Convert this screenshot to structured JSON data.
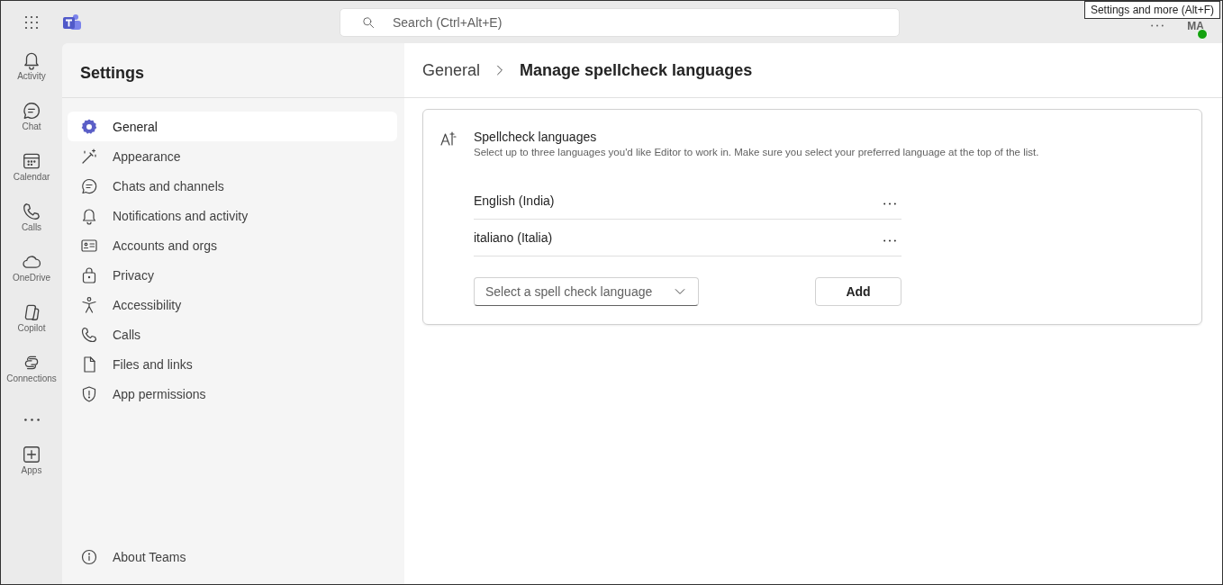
{
  "top_bar": {
    "search": {
      "placeholder": "Search (Ctrl+Alt+E)"
    },
    "avatar": {
      "initials": "MA",
      "status": {
        "color": "#13a10e"
      }
    },
    "tooltip": "Settings and more (Alt+F)"
  },
  "rail": {
    "items": [
      {
        "label": "Activity",
        "selected": false
      },
      {
        "label": "Chat",
        "selected": false
      },
      {
        "label": "Calendar",
        "selected": false
      },
      {
        "label": "Calls",
        "selected": false
      },
      {
        "label": "OneDrive",
        "selected": false
      },
      {
        "label": "Copilot",
        "selected": false
      },
      {
        "label": "Connections",
        "selected": false
      }
    ],
    "apps": {
      "label": "Apps"
    }
  },
  "settings": {
    "title": "Settings",
    "items": [
      {
        "label": "General",
        "selected": true
      },
      {
        "label": "Appearance",
        "selected": false
      },
      {
        "label": "Chats and channels",
        "selected": false
      },
      {
        "label": "Notifications and activity",
        "selected": false
      },
      {
        "label": "Accounts and orgs",
        "selected": false
      },
      {
        "label": "Privacy",
        "selected": false
      },
      {
        "label": "Accessibility",
        "selected": false
      },
      {
        "label": "Calls",
        "selected": false
      },
      {
        "label": "Files and links",
        "selected": false
      },
      {
        "label": "App permissions",
        "selected": false
      }
    ],
    "footer": "About Teams"
  },
  "breadcrumb": [
    "General",
    "Manage spellcheck languages"
  ],
  "card": {
    "title": "Spellcheck languages",
    "description": "Select up to three languages you'd like Editor to work in. Make sure you select your preferred language at the top of the list.",
    "languages": [
      "English (India)",
      "italiano (Italia)"
    ],
    "select": {
      "placeholder": "Select a spell check language"
    },
    "add_button": "Add"
  }
}
